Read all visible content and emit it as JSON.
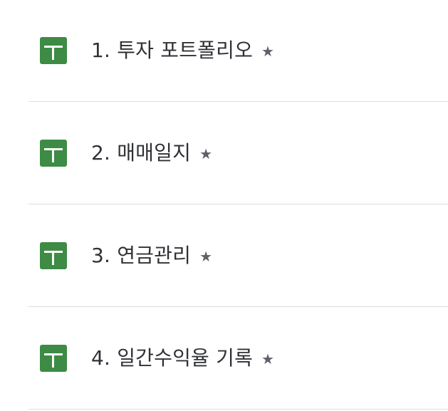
{
  "items": [
    {
      "label": "1. 투자 포트폴리오",
      "icon": "google-sheets-icon",
      "starred": true
    },
    {
      "label": "2. 매매일지",
      "icon": "google-sheets-icon",
      "starred": true
    },
    {
      "label": "3. 연금관리",
      "icon": "google-sheets-icon",
      "starred": true
    },
    {
      "label": "4. 일간수익율 기록",
      "icon": "google-sheets-icon",
      "starred": true
    }
  ],
  "star_glyph": "★",
  "colors": {
    "sheets_icon": "#3d8b45",
    "text": "#2f3136",
    "star": "#5d6168",
    "divider": "#dddddd"
  }
}
